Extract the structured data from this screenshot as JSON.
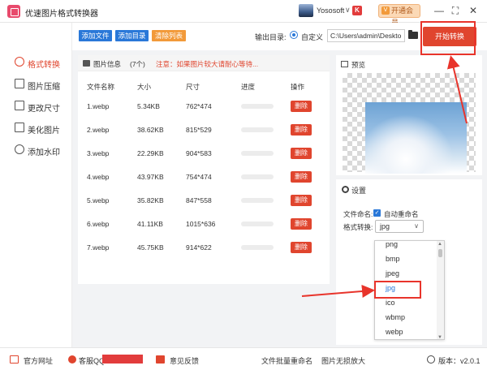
{
  "app": {
    "title": "优速图片格式转换器"
  },
  "titlebar": {
    "username": "Yososoft",
    "caret": "∨",
    "vip_label": "开通会员",
    "vip_crown": "V",
    "badge": "K",
    "minimize": "—",
    "maximize": "⛶",
    "close": "✕"
  },
  "nav": [
    {
      "label": "格式转换",
      "icon": "convert-icon",
      "active": true
    },
    {
      "label": "图片压缩",
      "icon": "compress-icon",
      "active": false
    },
    {
      "label": "更改尺寸",
      "icon": "resize-icon",
      "active": false
    },
    {
      "label": "美化图片",
      "icon": "beautify-icon",
      "active": false
    },
    {
      "label": "添加水印",
      "icon": "watermark-icon",
      "active": false
    }
  ],
  "toolbar": {
    "add_file": "添加文件",
    "add_folder": "添加目录",
    "clear_list": "清除列表",
    "output_label": "输出目录:",
    "output_option": "自定义",
    "output_path": "C:\\Users\\admin\\Deskto",
    "start": "开始转换"
  },
  "file_list": {
    "title": "图片信息",
    "count": "(7个)",
    "notice": "注意：如果图片较大请耐心等待...",
    "columns": [
      "文件名称",
      "大小",
      "尺寸",
      "进度",
      "操作"
    ],
    "delete_label": "删除",
    "rows": [
      {
        "name": "1.webp",
        "size": "5.34KB",
        "dims": "762*474",
        "progress": 0
      },
      {
        "name": "2.webp",
        "size": "38.62KB",
        "dims": "815*529",
        "progress": 0
      },
      {
        "name": "3.webp",
        "size": "22.29KB",
        "dims": "904*583",
        "progress": 0
      },
      {
        "name": "4.webp",
        "size": "43.97KB",
        "dims": "754*474",
        "progress": 0
      },
      {
        "name": "5.webp",
        "size": "35.82KB",
        "dims": "847*558",
        "progress": 0
      },
      {
        "name": "6.webp",
        "size": "41.11KB",
        "dims": "1015*636",
        "progress": 0
      },
      {
        "name": "7.webp",
        "size": "45.75KB",
        "dims": "914*622",
        "progress": 0
      }
    ]
  },
  "preview": {
    "label": "预览"
  },
  "settings": {
    "label": "设置",
    "naming_label": "文件命名:",
    "auto_rename": "自动重命名",
    "format_label": "格式转换:",
    "format_value": "jpg",
    "options": [
      "png",
      "bmp",
      "jpeg",
      "jpg",
      "ico",
      "wbmp",
      "webp"
    ],
    "selected": "jpg"
  },
  "footer": {
    "website": "官方网址",
    "support": "客服QQ",
    "feedback": "意见反馈",
    "batch_rename": "文件批量重命名",
    "lossless": "图片无损放大",
    "version": "版本：v2.0.1"
  },
  "colors": {
    "accent": "#e0452e",
    "blue": "#2a78d8",
    "highlight": "#e8342b",
    "progress": "#6cb55f"
  }
}
